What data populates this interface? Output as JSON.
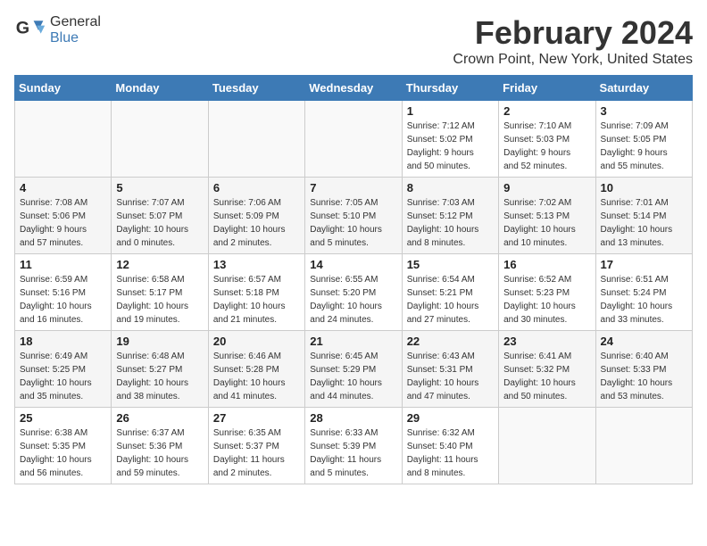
{
  "header": {
    "logo_general": "General",
    "logo_blue": "Blue",
    "month": "February 2024",
    "location": "Crown Point, New York, United States"
  },
  "days_of_week": [
    "Sunday",
    "Monday",
    "Tuesday",
    "Wednesday",
    "Thursday",
    "Friday",
    "Saturday"
  ],
  "weeks": [
    [
      {
        "day": "",
        "info": ""
      },
      {
        "day": "",
        "info": ""
      },
      {
        "day": "",
        "info": ""
      },
      {
        "day": "",
        "info": ""
      },
      {
        "day": "1",
        "info": "Sunrise: 7:12 AM\nSunset: 5:02 PM\nDaylight: 9 hours\nand 50 minutes."
      },
      {
        "day": "2",
        "info": "Sunrise: 7:10 AM\nSunset: 5:03 PM\nDaylight: 9 hours\nand 52 minutes."
      },
      {
        "day": "3",
        "info": "Sunrise: 7:09 AM\nSunset: 5:05 PM\nDaylight: 9 hours\nand 55 minutes."
      }
    ],
    [
      {
        "day": "4",
        "info": "Sunrise: 7:08 AM\nSunset: 5:06 PM\nDaylight: 9 hours\nand 57 minutes."
      },
      {
        "day": "5",
        "info": "Sunrise: 7:07 AM\nSunset: 5:07 PM\nDaylight: 10 hours\nand 0 minutes."
      },
      {
        "day": "6",
        "info": "Sunrise: 7:06 AM\nSunset: 5:09 PM\nDaylight: 10 hours\nand 2 minutes."
      },
      {
        "day": "7",
        "info": "Sunrise: 7:05 AM\nSunset: 5:10 PM\nDaylight: 10 hours\nand 5 minutes."
      },
      {
        "day": "8",
        "info": "Sunrise: 7:03 AM\nSunset: 5:12 PM\nDaylight: 10 hours\nand 8 minutes."
      },
      {
        "day": "9",
        "info": "Sunrise: 7:02 AM\nSunset: 5:13 PM\nDaylight: 10 hours\nand 10 minutes."
      },
      {
        "day": "10",
        "info": "Sunrise: 7:01 AM\nSunset: 5:14 PM\nDaylight: 10 hours\nand 13 minutes."
      }
    ],
    [
      {
        "day": "11",
        "info": "Sunrise: 6:59 AM\nSunset: 5:16 PM\nDaylight: 10 hours\nand 16 minutes."
      },
      {
        "day": "12",
        "info": "Sunrise: 6:58 AM\nSunset: 5:17 PM\nDaylight: 10 hours\nand 19 minutes."
      },
      {
        "day": "13",
        "info": "Sunrise: 6:57 AM\nSunset: 5:18 PM\nDaylight: 10 hours\nand 21 minutes."
      },
      {
        "day": "14",
        "info": "Sunrise: 6:55 AM\nSunset: 5:20 PM\nDaylight: 10 hours\nand 24 minutes."
      },
      {
        "day": "15",
        "info": "Sunrise: 6:54 AM\nSunset: 5:21 PM\nDaylight: 10 hours\nand 27 minutes."
      },
      {
        "day": "16",
        "info": "Sunrise: 6:52 AM\nSunset: 5:23 PM\nDaylight: 10 hours\nand 30 minutes."
      },
      {
        "day": "17",
        "info": "Sunrise: 6:51 AM\nSunset: 5:24 PM\nDaylight: 10 hours\nand 33 minutes."
      }
    ],
    [
      {
        "day": "18",
        "info": "Sunrise: 6:49 AM\nSunset: 5:25 PM\nDaylight: 10 hours\nand 35 minutes."
      },
      {
        "day": "19",
        "info": "Sunrise: 6:48 AM\nSunset: 5:27 PM\nDaylight: 10 hours\nand 38 minutes."
      },
      {
        "day": "20",
        "info": "Sunrise: 6:46 AM\nSunset: 5:28 PM\nDaylight: 10 hours\nand 41 minutes."
      },
      {
        "day": "21",
        "info": "Sunrise: 6:45 AM\nSunset: 5:29 PM\nDaylight: 10 hours\nand 44 minutes."
      },
      {
        "day": "22",
        "info": "Sunrise: 6:43 AM\nSunset: 5:31 PM\nDaylight: 10 hours\nand 47 minutes."
      },
      {
        "day": "23",
        "info": "Sunrise: 6:41 AM\nSunset: 5:32 PM\nDaylight: 10 hours\nand 50 minutes."
      },
      {
        "day": "24",
        "info": "Sunrise: 6:40 AM\nSunset: 5:33 PM\nDaylight: 10 hours\nand 53 minutes."
      }
    ],
    [
      {
        "day": "25",
        "info": "Sunrise: 6:38 AM\nSunset: 5:35 PM\nDaylight: 10 hours\nand 56 minutes."
      },
      {
        "day": "26",
        "info": "Sunrise: 6:37 AM\nSunset: 5:36 PM\nDaylight: 10 hours\nand 59 minutes."
      },
      {
        "day": "27",
        "info": "Sunrise: 6:35 AM\nSunset: 5:37 PM\nDaylight: 11 hours\nand 2 minutes."
      },
      {
        "day": "28",
        "info": "Sunrise: 6:33 AM\nSunset: 5:39 PM\nDaylight: 11 hours\nand 5 minutes."
      },
      {
        "day": "29",
        "info": "Sunrise: 6:32 AM\nSunset: 5:40 PM\nDaylight: 11 hours\nand 8 minutes."
      },
      {
        "day": "",
        "info": ""
      },
      {
        "day": "",
        "info": ""
      }
    ]
  ]
}
